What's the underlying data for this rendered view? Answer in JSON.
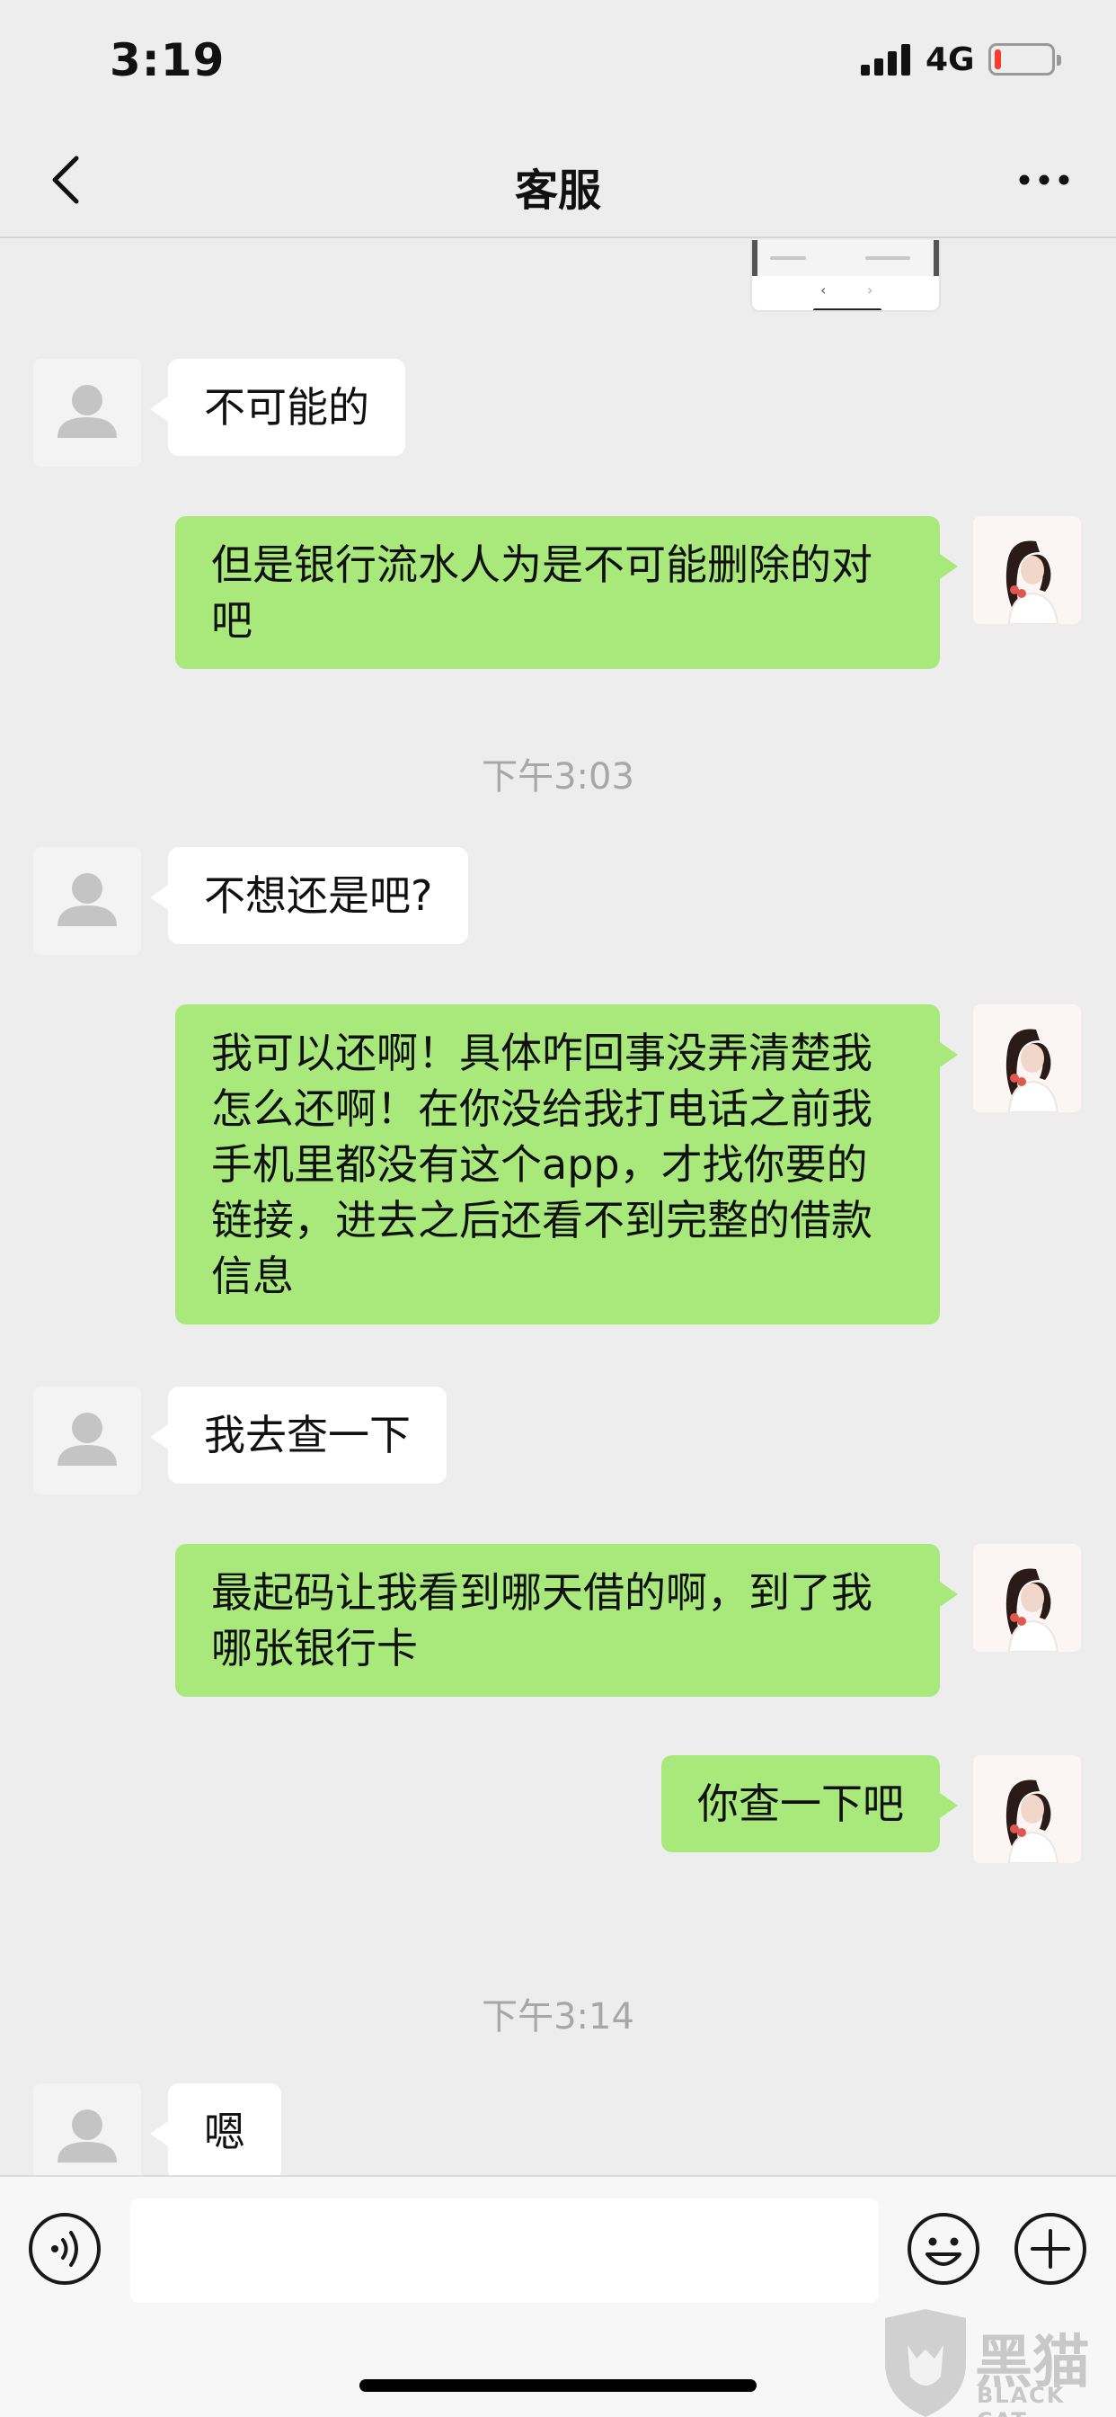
{
  "status_bar": {
    "time": "3:19",
    "network": "4G",
    "battery_level": 0.12,
    "battery_color": "#ff3b30"
  },
  "nav": {
    "title": "客服",
    "back_icon": "chevron-left-icon",
    "more_icon": "more-horizontal-icon"
  },
  "chat": {
    "image_preview": {
      "back_glyph": "‹",
      "forward_glyph": "›"
    },
    "timestamps": [
      "下午3:03",
      "下午3:14"
    ],
    "messages": [
      {
        "from": "agent",
        "text": "不可能的"
      },
      {
        "from": "me",
        "text": "但是银行流水人为是不可能删除的对吧"
      },
      {
        "from": "agent",
        "text": "不想还是吧?"
      },
      {
        "from": "me",
        "text": "我可以还啊！具体咋回事没弄清楚我怎么还啊！在你没给我打电话之前我手机里都没有这个app，才找你要的链接，进去之后还看不到完整的借款信息"
      },
      {
        "from": "agent",
        "text": "我去查一下"
      },
      {
        "from": "me",
        "text": "最起码让我看到哪天借的啊，到了我哪张银行卡"
      },
      {
        "from": "me",
        "text": "你查一下吧"
      },
      {
        "from": "agent",
        "text": "嗯"
      }
    ]
  },
  "input_bar": {
    "voice_icon": "voice-icon",
    "emoji_icon": "emoji-icon",
    "plus_icon": "plus-icon",
    "message_value": ""
  },
  "watermark": {
    "title": "黑猫",
    "subtitle": "BLACK CAT"
  },
  "colors": {
    "background": "#ededed",
    "outgoing_bubble": "#a9e97c",
    "incoming_bubble": "#ffffff",
    "timestamp": "#a7a7a7"
  }
}
